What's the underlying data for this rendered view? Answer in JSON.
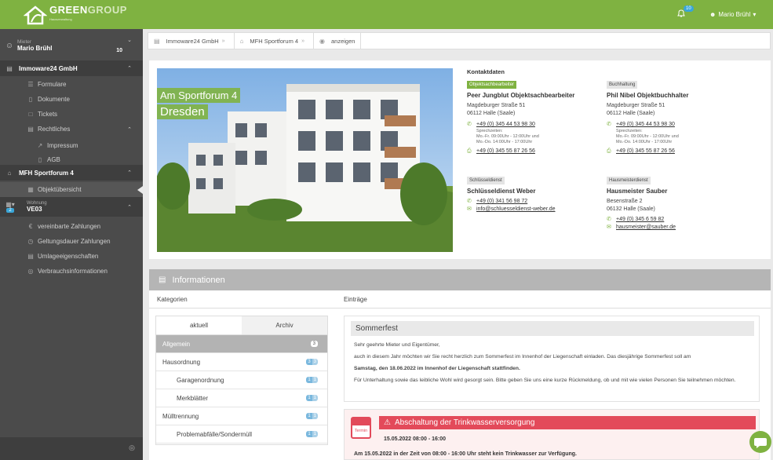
{
  "header": {
    "brand": "GREEN",
    "brand2": "GROUP",
    "brand_sub": "Hausverwaltung",
    "notification_count": "10",
    "user_name": "Mario Brühl",
    "accent": "#7fb241"
  },
  "sidebar": {
    "tenant_label": "Mieter",
    "tenant_name": "Mario Brühl",
    "tenant_count": "10",
    "company": "Immoware24 GmbH",
    "items": [
      "Formulare",
      "Dokumente",
      "Tickets",
      "Rechtliches"
    ],
    "sub_items": [
      "Impressum",
      "AGB"
    ],
    "property": "MFH Sportforum 4",
    "property_item": "Objektübersicht",
    "unit_label": "Wohnung",
    "unit_badge": "2",
    "unit_name": "VE03",
    "unit_items": [
      "vereinbarte Zahlungen",
      "Geltungsdauer Zahlungen",
      "Umlageeigenschaften",
      "Verbrauchsinformationen"
    ]
  },
  "breadcrumb": [
    "Immoware24 GmbH",
    "MFH Sportforum 4",
    "anzeigen"
  ],
  "property_card": {
    "street": "Am Sportforum 4",
    "city": "Dresden"
  },
  "contacts": {
    "heading": "Kontaktdaten",
    "c1": {
      "tag": "Objektsachbearbeiter",
      "name": "Peer Jungblut Objektsachbearbeiter",
      "street": "Magdeburger Straße 51",
      "city": "06112 Halle (Saale)",
      "phone": "+49 (0) 345 44 53 98 30",
      "hours_label": "Sprechzeiten:",
      "hours1": "Mo.-Fr. 09:00Uhr - 12:00Uhr und",
      "hours2": "Mo.-Do. 14:00Uhr - 17:00Uhr",
      "fax": "+49 (0) 345 55 87 26 56"
    },
    "c2": {
      "tag": "Buchhaltung",
      "name": "Phil Nibel Objektbuchhalter",
      "street": "Magdeburger Straße 51",
      "city": "06112 Halle (Saale)",
      "phone": "+49 (0) 345 44 53 98 30",
      "hours_label": "Sprechzeiten:",
      "hours1": "Mo.-Fr. 09:00Uhr - 12:00Uhr und",
      "hours2": "Mo.-Do. 14:00Uhr - 17:00Uhr",
      "fax": "+49 (0) 345 55 87 26 56"
    },
    "c3": {
      "tag": "Schlüsseldienst",
      "name": "Schlüsseldienst Weber",
      "phone": "+49 (0) 341 56 98 72",
      "email": "info@schluesseldienst-weber.de"
    },
    "c4": {
      "tag": "Hausmeisterdienst",
      "name": "Hausmeister Sauber",
      "street": "Besenstraße 2",
      "city": "06132 Halle (Saale)",
      "phone": "+49 (0) 345 6 59 82",
      "email": "hausmeister@sauber.de"
    }
  },
  "info": {
    "title": "Informationen",
    "col_categories": "Kategorien",
    "col_entries": "Einträge",
    "tab_current": "aktuell",
    "tab_archive": "Archiv",
    "categories": [
      {
        "label": "Allgemein",
        "badge": "3",
        "badge2": ""
      },
      {
        "label": "Hausordnung",
        "badge": "3",
        "badge2": "3"
      },
      {
        "label": "Garagenordnung",
        "badge": "1",
        "badge2": "1"
      },
      {
        "label": "Merkblätter",
        "badge": "1",
        "badge2": "1"
      },
      {
        "label": "Mülltrennung",
        "badge": "1",
        "badge2": "1"
      },
      {
        "label": "Problemabfälle/Sondermüll",
        "badge": "1",
        "badge2": "1"
      }
    ],
    "entry1": {
      "title": "Sommerfest",
      "p1": "Sehr geehrte Mieter und Eigentümer,",
      "p2": "auch in diesem Jahr möchten wir Sie recht herzlich zum Sommerfest im Innenhof der Liegenschaft einladen. Das diesjährige Sommerfest soll am",
      "p3": "Samstag, den 18.06.2022 im Innenhof der Liegenschaft stattfinden.",
      "p4": "Für Unterhaltung sowie das leibliche Wohl wird gesorgt sein. Bitte geben Sie uns eine kurze Rückmeldung, ob und mit wie vielen Personen Sie teilnehmen möchten."
    },
    "entry2": {
      "calendar_label": "Termin",
      "title": "Abschaltung der Trinkwasserversorgung",
      "date": "15.05.2022 08:00 - 16:00",
      "message": "Am 15.05.2022 in der Zeit von 08:00 - 16:00 Uhr steht kein Trinkwasser zur Verfügung."
    }
  }
}
